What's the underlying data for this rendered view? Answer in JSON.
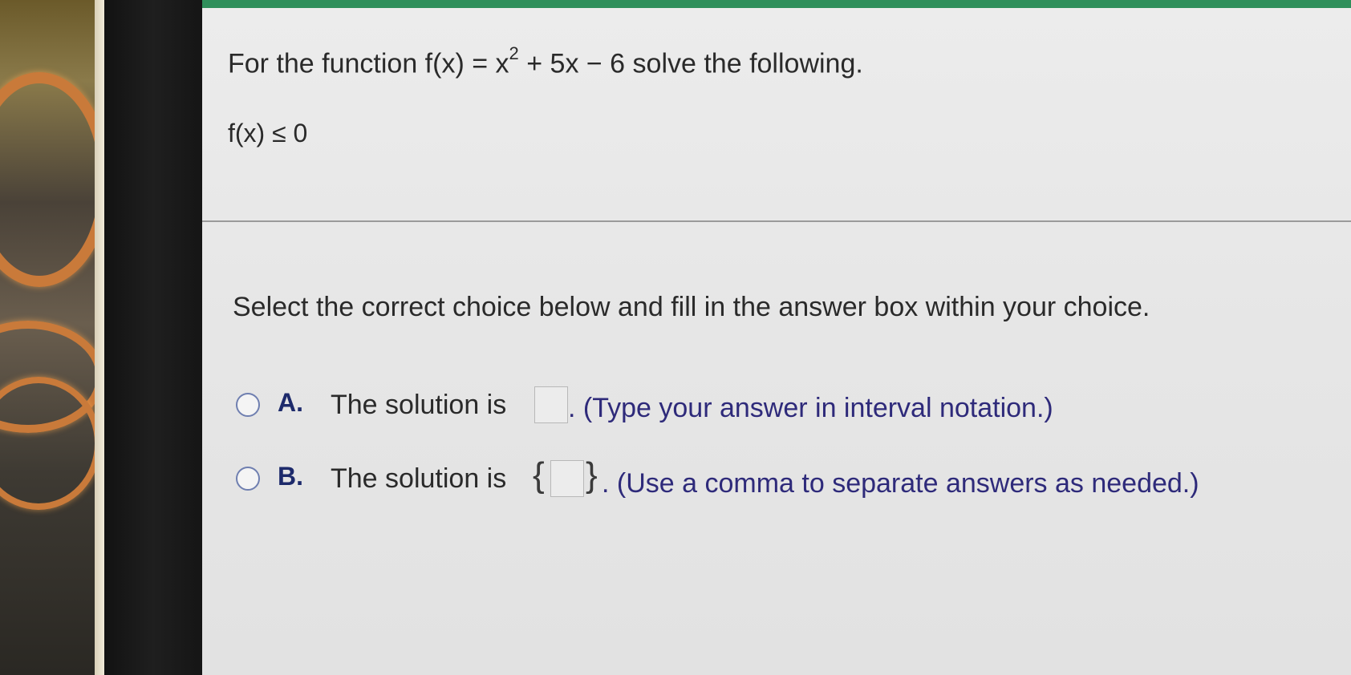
{
  "question": {
    "prefix": "For the function f(x) = x",
    "exponent": "2",
    "suffix": " + 5x − 6 solve the following.",
    "inequality": "f(x) ≤ 0"
  },
  "instruction": "Select the correct choice below and fill in the answer box within your choice.",
  "choices": [
    {
      "letter": "A.",
      "text": "The solution is",
      "answer_value": "",
      "hint": ". (Type your answer in interval notation.)"
    },
    {
      "letter": "B.",
      "text": "The solution is",
      "brace_open": "{",
      "answer_value": "",
      "brace_close": "}",
      "hint": ". (Use a comma to separate answers as needed.)"
    }
  ],
  "colors": {
    "topbar": "#2f8f5b",
    "letter": "#1d2a6b",
    "hint": "#2e2a7a",
    "radio_border": "#6f7fb0"
  }
}
